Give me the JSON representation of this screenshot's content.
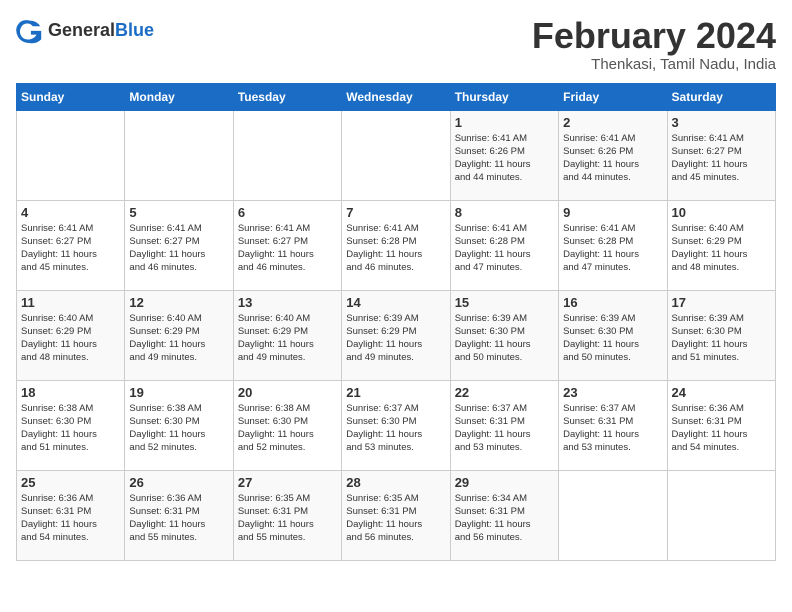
{
  "logo": {
    "general": "General",
    "blue": "Blue"
  },
  "title": "February 2024",
  "location": "Thenkasi, Tamil Nadu, India",
  "days_header": [
    "Sunday",
    "Monday",
    "Tuesday",
    "Wednesday",
    "Thursday",
    "Friday",
    "Saturday"
  ],
  "weeks": [
    [
      {
        "num": "",
        "detail": ""
      },
      {
        "num": "",
        "detail": ""
      },
      {
        "num": "",
        "detail": ""
      },
      {
        "num": "",
        "detail": ""
      },
      {
        "num": "1",
        "detail": "Sunrise: 6:41 AM\nSunset: 6:26 PM\nDaylight: 11 hours\nand 44 minutes."
      },
      {
        "num": "2",
        "detail": "Sunrise: 6:41 AM\nSunset: 6:26 PM\nDaylight: 11 hours\nand 44 minutes."
      },
      {
        "num": "3",
        "detail": "Sunrise: 6:41 AM\nSunset: 6:27 PM\nDaylight: 11 hours\nand 45 minutes."
      }
    ],
    [
      {
        "num": "4",
        "detail": "Sunrise: 6:41 AM\nSunset: 6:27 PM\nDaylight: 11 hours\nand 45 minutes."
      },
      {
        "num": "5",
        "detail": "Sunrise: 6:41 AM\nSunset: 6:27 PM\nDaylight: 11 hours\nand 46 minutes."
      },
      {
        "num": "6",
        "detail": "Sunrise: 6:41 AM\nSunset: 6:27 PM\nDaylight: 11 hours\nand 46 minutes."
      },
      {
        "num": "7",
        "detail": "Sunrise: 6:41 AM\nSunset: 6:28 PM\nDaylight: 11 hours\nand 46 minutes."
      },
      {
        "num": "8",
        "detail": "Sunrise: 6:41 AM\nSunset: 6:28 PM\nDaylight: 11 hours\nand 47 minutes."
      },
      {
        "num": "9",
        "detail": "Sunrise: 6:41 AM\nSunset: 6:28 PM\nDaylight: 11 hours\nand 47 minutes."
      },
      {
        "num": "10",
        "detail": "Sunrise: 6:40 AM\nSunset: 6:29 PM\nDaylight: 11 hours\nand 48 minutes."
      }
    ],
    [
      {
        "num": "11",
        "detail": "Sunrise: 6:40 AM\nSunset: 6:29 PM\nDaylight: 11 hours\nand 48 minutes."
      },
      {
        "num": "12",
        "detail": "Sunrise: 6:40 AM\nSunset: 6:29 PM\nDaylight: 11 hours\nand 49 minutes."
      },
      {
        "num": "13",
        "detail": "Sunrise: 6:40 AM\nSunset: 6:29 PM\nDaylight: 11 hours\nand 49 minutes."
      },
      {
        "num": "14",
        "detail": "Sunrise: 6:39 AM\nSunset: 6:29 PM\nDaylight: 11 hours\nand 49 minutes."
      },
      {
        "num": "15",
        "detail": "Sunrise: 6:39 AM\nSunset: 6:30 PM\nDaylight: 11 hours\nand 50 minutes."
      },
      {
        "num": "16",
        "detail": "Sunrise: 6:39 AM\nSunset: 6:30 PM\nDaylight: 11 hours\nand 50 minutes."
      },
      {
        "num": "17",
        "detail": "Sunrise: 6:39 AM\nSunset: 6:30 PM\nDaylight: 11 hours\nand 51 minutes."
      }
    ],
    [
      {
        "num": "18",
        "detail": "Sunrise: 6:38 AM\nSunset: 6:30 PM\nDaylight: 11 hours\nand 51 minutes."
      },
      {
        "num": "19",
        "detail": "Sunrise: 6:38 AM\nSunset: 6:30 PM\nDaylight: 11 hours\nand 52 minutes."
      },
      {
        "num": "20",
        "detail": "Sunrise: 6:38 AM\nSunset: 6:30 PM\nDaylight: 11 hours\nand 52 minutes."
      },
      {
        "num": "21",
        "detail": "Sunrise: 6:37 AM\nSunset: 6:30 PM\nDaylight: 11 hours\nand 53 minutes."
      },
      {
        "num": "22",
        "detail": "Sunrise: 6:37 AM\nSunset: 6:31 PM\nDaylight: 11 hours\nand 53 minutes."
      },
      {
        "num": "23",
        "detail": "Sunrise: 6:37 AM\nSunset: 6:31 PM\nDaylight: 11 hours\nand 53 minutes."
      },
      {
        "num": "24",
        "detail": "Sunrise: 6:36 AM\nSunset: 6:31 PM\nDaylight: 11 hours\nand 54 minutes."
      }
    ],
    [
      {
        "num": "25",
        "detail": "Sunrise: 6:36 AM\nSunset: 6:31 PM\nDaylight: 11 hours\nand 54 minutes."
      },
      {
        "num": "26",
        "detail": "Sunrise: 6:36 AM\nSunset: 6:31 PM\nDaylight: 11 hours\nand 55 minutes."
      },
      {
        "num": "27",
        "detail": "Sunrise: 6:35 AM\nSunset: 6:31 PM\nDaylight: 11 hours\nand 55 minutes."
      },
      {
        "num": "28",
        "detail": "Sunrise: 6:35 AM\nSunset: 6:31 PM\nDaylight: 11 hours\nand 56 minutes."
      },
      {
        "num": "29",
        "detail": "Sunrise: 6:34 AM\nSunset: 6:31 PM\nDaylight: 11 hours\nand 56 minutes."
      },
      {
        "num": "",
        "detail": ""
      },
      {
        "num": "",
        "detail": ""
      }
    ]
  ]
}
